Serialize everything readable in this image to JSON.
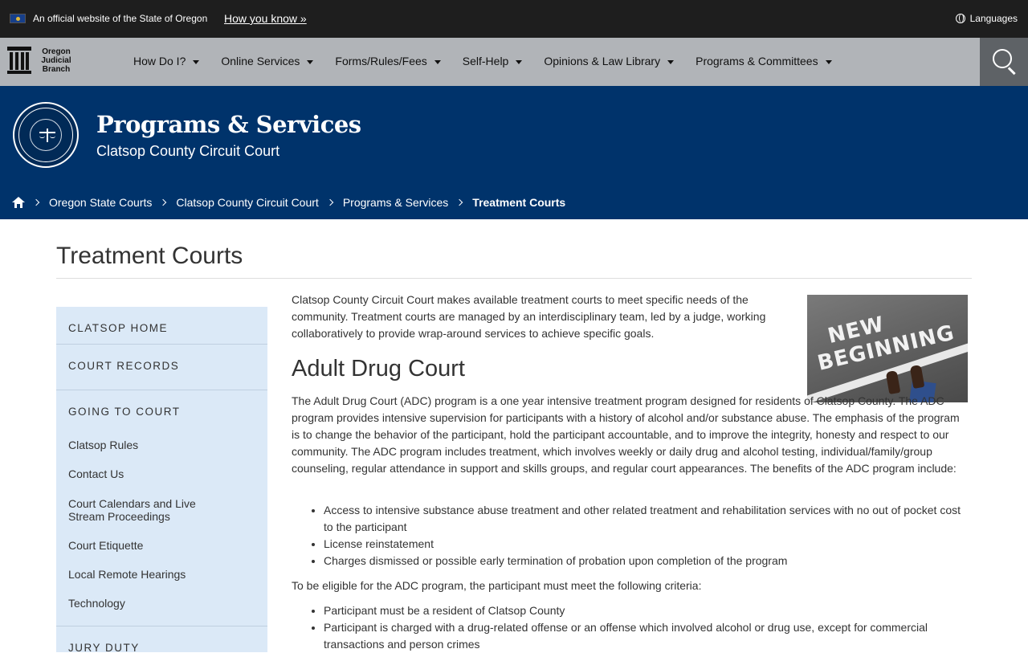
{
  "gov_bar": {
    "official_text": "An official website of the State of Oregon",
    "how_you_know": "How you know »",
    "languages": "Languages"
  },
  "nav": {
    "logo_lines": [
      "Oregon",
      "Judicial",
      "Branch"
    ],
    "items": [
      {
        "label": "How Do I?"
      },
      {
        "label": "Online Services"
      },
      {
        "label": "Forms/Rules/Fees"
      },
      {
        "label": "Self-Help"
      },
      {
        "label": "Opinions & Law Library"
      },
      {
        "label": "Programs & Committees"
      }
    ]
  },
  "banner": {
    "title": "Programs & Services",
    "subtitle": "Clatsop County Circuit Court"
  },
  "breadcrumb": [
    {
      "label": "Oregon State Courts"
    },
    {
      "label": "Clatsop County Circuit Court"
    },
    {
      "label": "Programs & Services"
    },
    {
      "label": "Treatment Courts"
    }
  ],
  "page": {
    "title": "Treatment Courts"
  },
  "sidebar": {
    "sections": [
      {
        "heading": "CLATSOP HOME"
      },
      {
        "heading": "COURT RECORDS"
      },
      {
        "heading": "GOING TO COURT"
      },
      {
        "heading": "JURY DUTY"
      }
    ],
    "links": [
      {
        "label": "Clatsop Rules"
      },
      {
        "label": "Contact Us"
      },
      {
        "label": "Court Calendars and Live Stream Proceedings"
      },
      {
        "label": "Court Etiquette"
      },
      {
        "label": "Local Remote Hearings"
      },
      {
        "label": "Technology"
      }
    ]
  },
  "content": {
    "intro": "Clatsop County Circuit Court makes available treatment courts to meet specific needs of the community. Treatment courts are managed by an interdisciplinary team, led by a judge, working collaboratively to provide wrap-around services to achieve specific goals.",
    "image_text": [
      "NEW",
      "BEGINNING"
    ],
    "adc_heading": "Adult Drug Court",
    "adc_paragraph": "The Adult Drug Court (ADC) program is a one year intensive treatment program designed for residents of Clatsop County. The ADC program provides intensive supervision for participants with a history of alcohol and/or substance abuse. The emphasis of the program is to change the behavior of the participant, hold the participant accountable, and to improve the integrity, honesty and respect to our community. The ADC program includes treatment, which involves weekly or daily drug and alcohol testing, individual/family/group counseling, regular attendance in support and skills groups, and regular court appearances. The benefits of the ADC program include:",
    "benefits": [
      "Access to intensive substance abuse treatment and other related treatment and rehabilitation services with no out of pocket cost to the participant",
      "License reinstatement",
      "Charges dismissed or possible early termination of probation upon completion of the program"
    ],
    "eligibility_intro": "To be eligible for the ADC program, the participant must meet the following criteria:",
    "criteria": [
      "Participant must be a resident of Clatsop County",
      "Participant is charged with a drug-related offense or an offense which involved alcohol or drug use, except for commercial transactions and person crimes"
    ]
  }
}
